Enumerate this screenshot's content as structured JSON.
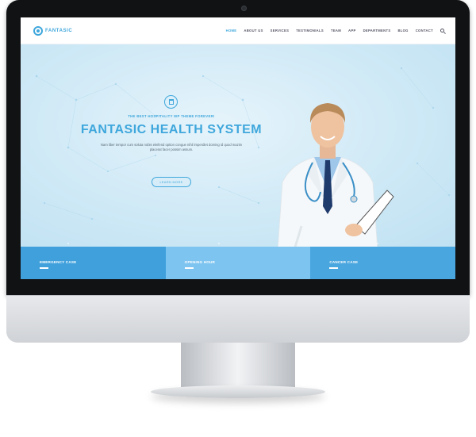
{
  "brand": {
    "name": "FANTASIC",
    "logo_icon": "gear-logo-icon",
    "accent": "#3fa7dc"
  },
  "nav": {
    "items": [
      {
        "label": "HOME",
        "active": true
      },
      {
        "label": "ABOUT US"
      },
      {
        "label": "SERVICES"
      },
      {
        "label": "TESTIMONIALS"
      },
      {
        "label": "TEAM"
      },
      {
        "label": "APP"
      },
      {
        "label": "DEPARTMENTS"
      },
      {
        "label": "BLOG"
      },
      {
        "label": "CONTACT"
      }
    ],
    "search_icon": "search-icon"
  },
  "hero": {
    "icon": "hospital-icon",
    "tagline": "THE BEST HOSPITALITY WP THEME FOREVER!",
    "headline": "FANTASIC HEALTH SYSTEM",
    "body": "Nam liber tempor cum soluta nobis eleifend option congue nihil imperdiet doming id quod mazim placerat facer possim assum.",
    "button": "LEARN MORE",
    "background": "#cfe9f6"
  },
  "features": [
    {
      "label": "EMERGENCY CASE",
      "color": "#3fa0dc"
    },
    {
      "label": "OPENING HOUR",
      "color": "#7ec4f0"
    },
    {
      "label": "CANCER CASE",
      "color": "#4aa6de"
    }
  ]
}
